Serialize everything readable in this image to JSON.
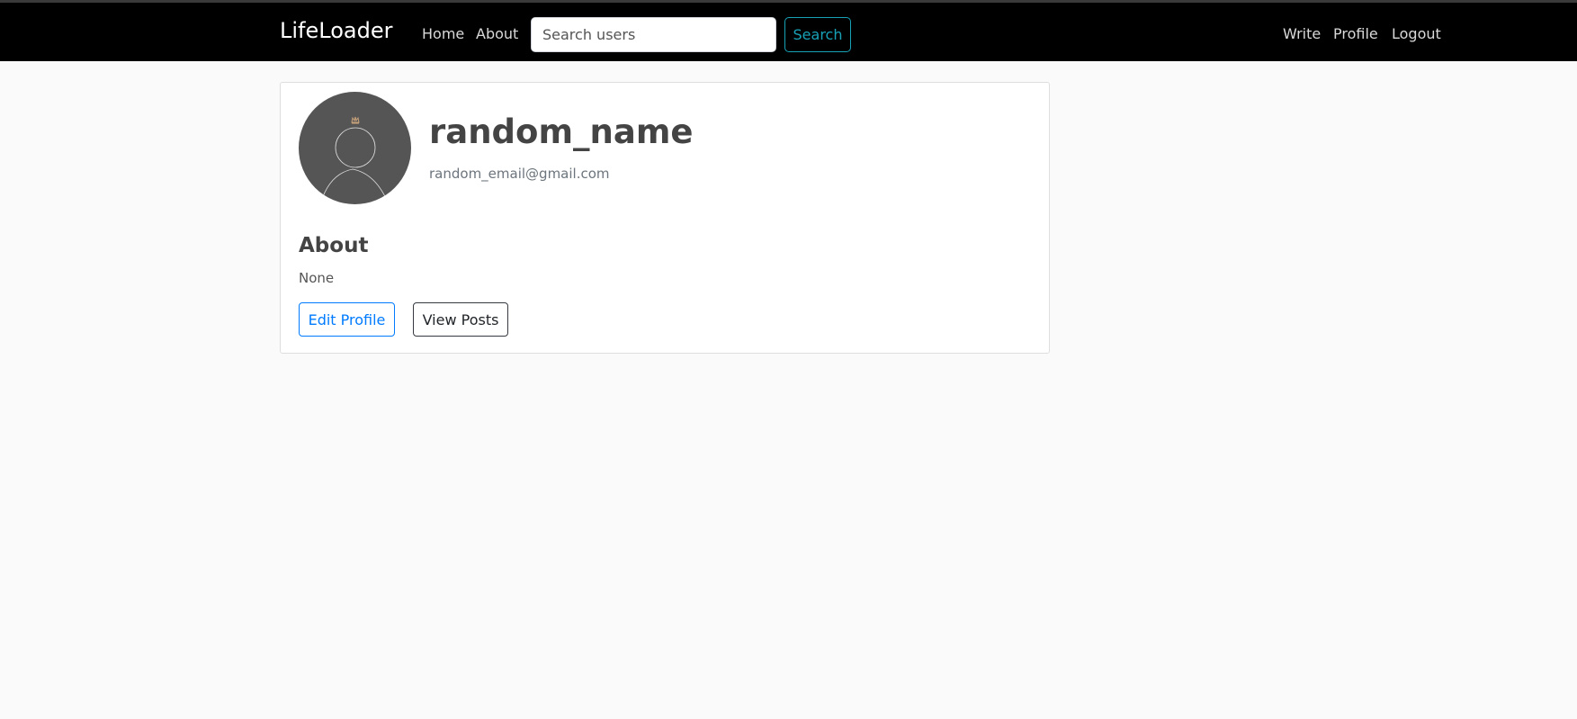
{
  "navbar": {
    "brand": "LifeLoader",
    "links": {
      "home": "Home",
      "about": "About"
    },
    "search": {
      "placeholder": "Search users",
      "value": "",
      "button_label": "Search"
    },
    "right_links": {
      "write": "Write",
      "profile": "Profile",
      "logout": "Logout"
    }
  },
  "profile": {
    "username": "random_name",
    "email": "random_email@gmail.com",
    "about_heading": "About",
    "about_text": "None",
    "edit_button": "Edit Profile",
    "posts_button": "View Posts"
  },
  "colors": {
    "navbar_bg": "#000000",
    "search_accent": "#17a2b8",
    "edit_accent": "#007bff",
    "avatar_bg": "#555555"
  }
}
